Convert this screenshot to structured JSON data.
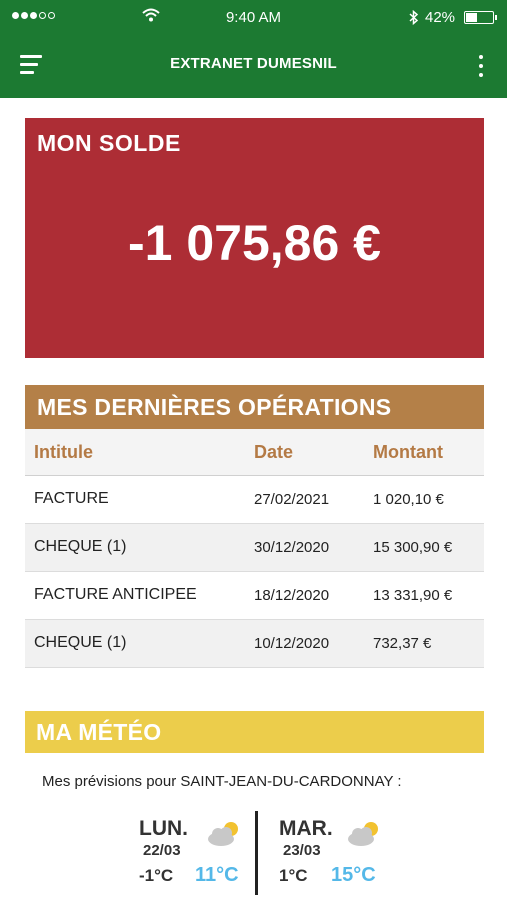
{
  "status_bar": {
    "time": "9:40 AM",
    "battery": "42%",
    "battery_level": 0.42,
    "signal_bars_filled": 3,
    "signal_bars_total": 5
  },
  "app_bar": {
    "title": "EXTRANET DUMESNIL",
    "menu_icon": "hamburger-menu-icon",
    "more_icon": "kebab-more-icon"
  },
  "solde": {
    "title": "MON SOLDE",
    "amount": "-1 075,86 €",
    "background": "#ad2d35"
  },
  "operations": {
    "title": "MES DERNIÈRES OPÉRATIONS",
    "columns": [
      "Intitule",
      "Date",
      "Montant"
    ],
    "rows": [
      {
        "label": "FACTURE",
        "date": "27/02/2021",
        "amount": "1 020,10 €"
      },
      {
        "label": "CHEQUE (1)",
        "date": "30/12/2020",
        "amount": "15 300,90 €"
      },
      {
        "label": "FACTURE ANTICIPEE",
        "date": "18/12/2020",
        "amount": "13 331,90 €"
      },
      {
        "label": "CHEQUE (1)",
        "date": "10/12/2020",
        "amount": "732,37 €"
      }
    ],
    "header_color": "#b48048"
  },
  "meteo": {
    "title": "MA MÉTÉO",
    "subtitle": "Mes prévisions pour SAINT-JEAN-DU-CARDONNAY :",
    "header_color": "#eccd4b",
    "days": [
      {
        "name": "LUN.",
        "date": "22/03",
        "min": "-1°C",
        "max": "11°C",
        "icon": "partly-cloudy-icon"
      },
      {
        "name": "MAR.",
        "date": "23/03",
        "min": "1°C",
        "max": "15°C",
        "icon": "partly-cloudy-icon"
      }
    ]
  },
  "colors": {
    "brand_green": "#1c7a32",
    "temp_max_blue": "#54b8e8"
  }
}
